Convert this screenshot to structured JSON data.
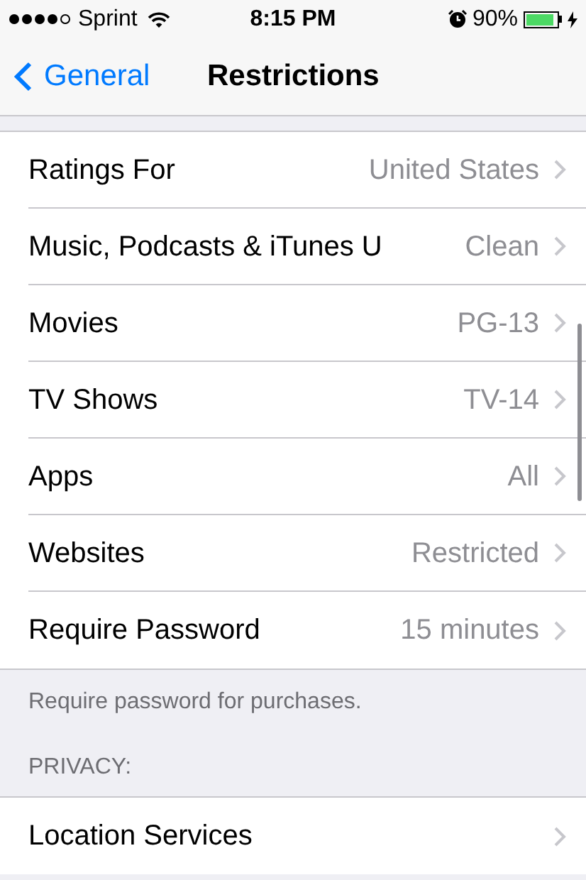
{
  "status_bar": {
    "carrier": "Sprint",
    "time": "8:15 PM",
    "battery_percent": "90%",
    "battery": {
      "level": 0.9
    }
  },
  "nav_bar": {
    "back": "General",
    "title": "Restrictions"
  },
  "allowed_content": [
    {
      "label": "Ratings For",
      "value": "United States"
    },
    {
      "label": "Music, Podcasts & iTunes U",
      "value": "Clean"
    },
    {
      "label": "Movies",
      "value": "PG-13"
    },
    {
      "label": "TV Shows",
      "value": "TV-14"
    },
    {
      "label": "Apps",
      "value": "All"
    },
    {
      "label": "Websites",
      "value": "Restricted"
    },
    {
      "label": "Require Password",
      "value": "15 minutes"
    }
  ],
  "allowed_footer": "Require password for purchases.",
  "privacy": {
    "header": "PRIVACY:",
    "items": [
      {
        "label": "Location Services"
      }
    ]
  }
}
